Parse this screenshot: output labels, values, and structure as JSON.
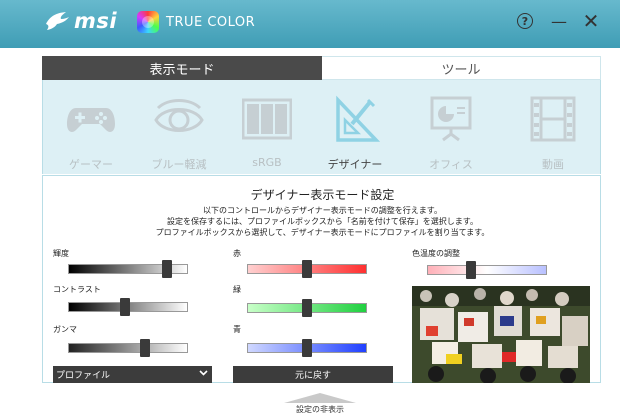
{
  "header": {
    "brand": "msi",
    "product": "TRUE COLOR",
    "help_glyph": "?",
    "minimize_glyph": "—",
    "close_glyph": "✕"
  },
  "tabs": [
    {
      "label": "表示モード",
      "active": true
    },
    {
      "label": "ツール",
      "active": false
    }
  ],
  "modes": [
    {
      "label": "ゲーマー",
      "icon": "gamepad-icon",
      "active": false
    },
    {
      "label": "ブルー軽減",
      "icon": "eye-icon",
      "active": false
    },
    {
      "label": "sRGB",
      "icon": "grid-icon",
      "active": false
    },
    {
      "label": "デザイナー",
      "icon": "ruler-triangle-icon",
      "active": true
    },
    {
      "label": "オフィス",
      "icon": "presentation-icon",
      "active": false
    },
    {
      "label": "動画",
      "icon": "film-icon",
      "active": false
    }
  ],
  "designer": {
    "title": "デザイナー表示モード設定",
    "desc_lines": [
      "以下のコントロールからデザイナー表示モードの調整を行えます。",
      "設定を保存するには、プロファイルボックスから「名前を付けて保存」を選択します。",
      "プロファイルボックスから選択して、デザイナー表示モードにプロファイルを割り当てます。"
    ],
    "controls": {
      "brightness": {
        "label": "輝度",
        "value": 0.85
      },
      "contrast": {
        "label": "コントラスト",
        "value": 0.47
      },
      "gamma": {
        "label": "ガンマ",
        "value": 0.65
      },
      "red": {
        "label": "赤",
        "value": 0.5
      },
      "green": {
        "label": "緑",
        "value": 0.5
      },
      "blue": {
        "label": "青",
        "value": 0.5
      },
      "color_temp": {
        "label": "色温度の調整",
        "value": 0.35
      }
    },
    "profile_label": "プロファイル",
    "reset_label": "元に戻す"
  },
  "footer": {
    "hide_label": "設定の非表示"
  },
  "colors": {
    "header": "#4aa7bf",
    "mode_panel": "#ddf0f5",
    "dark_button": "#3c3c3c",
    "red_track": "#ff5050",
    "green_track": "#40e050",
    "blue_track": "#4060ff"
  }
}
